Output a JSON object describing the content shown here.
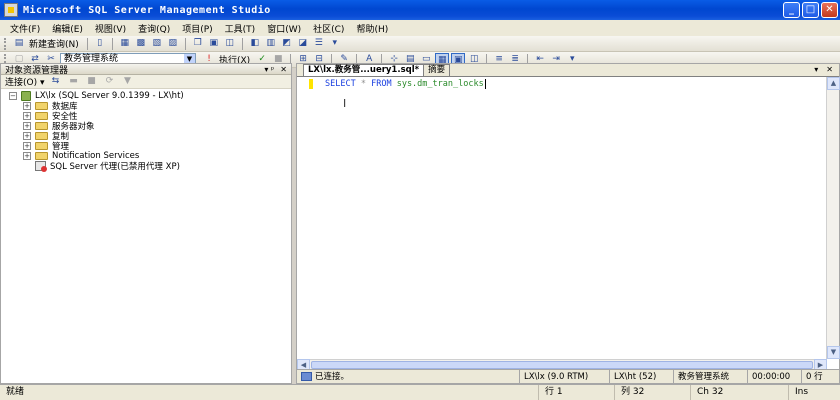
{
  "window": {
    "title": "Microsoft SQL Server Management Studio",
    "min": "_",
    "max": "□",
    "close": "✕"
  },
  "menu": [
    "文件(F)",
    "编辑(E)",
    "视图(V)",
    "查询(Q)",
    "项目(P)",
    "工具(T)",
    "窗口(W)",
    "社区(C)",
    "帮助(H)"
  ],
  "toolbar": {
    "new_query_label": "新建查询(N)"
  },
  "query_toolbar": {
    "database": "教务管理系统",
    "execute_label": "执行(X)"
  },
  "object_explorer": {
    "title": "对象资源管理器",
    "pin": "▾  ᵖ",
    "close": "✕",
    "connect_label": "连接(O) ▾",
    "server_node": "LX\\lx (SQL Server 9.0.1399 - LX\\ht)",
    "children": [
      "数据库",
      "安全性",
      "服务器对象",
      "复制",
      "管理",
      "Notification Services"
    ],
    "agent_node": "SQL Server 代理(已禁用代理 XP)"
  },
  "editor": {
    "tabs": [
      "LX\\lx.教务管...uery1.sql*",
      "摘要"
    ],
    "code": {
      "kw1": "SELECT",
      "op": "*",
      "kw2": "FROM",
      "obj": "sys.dm_tran_locks"
    }
  },
  "query_status": {
    "connected": "已连接。",
    "server": "LX\\lx (9.0 RTM)",
    "user": "LX\\ht (52)",
    "database": "教务管理系统",
    "time": "00:00:00",
    "rows": "0 行"
  },
  "statusbar": {
    "ready": "就绪",
    "line": "行 1",
    "col": "列 32",
    "ch": "Ch 32",
    "ins": "Ins"
  }
}
